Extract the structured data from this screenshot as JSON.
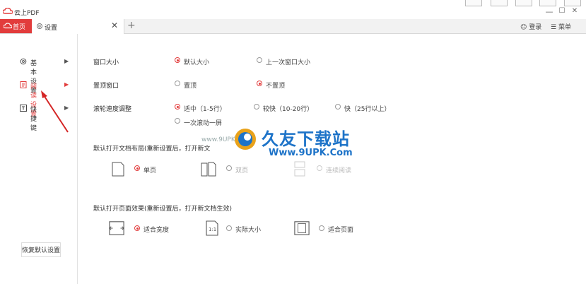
{
  "app": {
    "title": "云上PDF"
  },
  "window": {
    "minimize": "—",
    "maximize": "☐",
    "close": "✕"
  },
  "tabs": {
    "home_label": "首页",
    "settings_label": "设置",
    "close_glyph": "✕",
    "new_tab_glyph": "+"
  },
  "header": {
    "login_label": "登录",
    "menu_label": "菜单"
  },
  "sidebar": {
    "items": [
      {
        "label": "基本设置",
        "icon": "gear-icon",
        "active": false
      },
      {
        "label": "阅读设置",
        "icon": "document-icon",
        "active": true
      },
      {
        "label": "快捷键",
        "icon": "keyboard-icon",
        "active": false
      }
    ],
    "arrow": "▶",
    "restore_label": "恢复默认设置"
  },
  "settings": {
    "window_size": {
      "label": "窗口大小",
      "options": [
        {
          "label": "默认大小",
          "checked": true
        },
        {
          "label": "上一次窗口大小",
          "checked": false
        }
      ]
    },
    "pin_window": {
      "label": "置顶窗口",
      "options": [
        {
          "label": "置顶",
          "checked": false
        },
        {
          "label": "不置顶",
          "checked": true
        }
      ]
    },
    "scroll_speed": {
      "label": "滚轮速度调整",
      "options": [
        {
          "label": "适中（1-5行）",
          "checked": true
        },
        {
          "label": "较快（10-20行）",
          "checked": false
        },
        {
          "label": "快（25行以上）",
          "checked": false
        },
        {
          "label": "一次滚动一屏",
          "checked": false
        }
      ]
    },
    "default_layout": {
      "title": "默认打开文档布局(重新设置后，打开新文",
      "options": [
        {
          "label": "单页",
          "checked": true
        },
        {
          "label": "双页",
          "checked": false
        },
        {
          "label": "连续阅读",
          "checked": false
        }
      ]
    },
    "default_zoom": {
      "title": "默认打开页面效果(重新设置后，打开新文档生效)",
      "options": [
        {
          "label": "适合宽度",
          "checked": true
        },
        {
          "label": "实际大小",
          "checked": false
        },
        {
          "label": "适合页面",
          "checked": false
        }
      ]
    }
  },
  "watermark": {
    "title": "久友下载站",
    "url": "Www.9UPK.Com",
    "small": "www.9UPK.com"
  },
  "colors": {
    "accent": "#e23c3c",
    "watermark_blue": "#1d73c8"
  }
}
